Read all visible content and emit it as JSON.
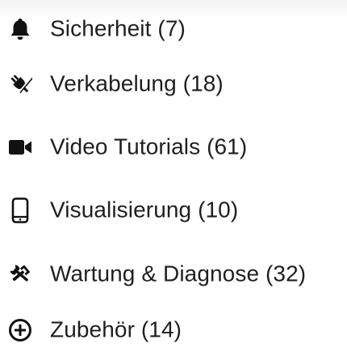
{
  "menu": {
    "items": [
      {
        "label": "Sicherheit (7)",
        "icon": "bell-icon"
      },
      {
        "label": "Verkabelung (18)",
        "icon": "plug-icon"
      },
      {
        "label": "Video Tutorials (61)",
        "icon": "video-camera-icon"
      },
      {
        "label": "Visualisierung (10)",
        "icon": "mobile-phone-icon"
      },
      {
        "label": "Wartung & Diagnose (32)",
        "icon": "tools-icon"
      },
      {
        "label": "Zubehör (14)",
        "icon": "plus-circle-icon"
      }
    ]
  },
  "colors": {
    "text": "#1f1f1f",
    "icon": "#111111",
    "background": "#ffffff"
  }
}
